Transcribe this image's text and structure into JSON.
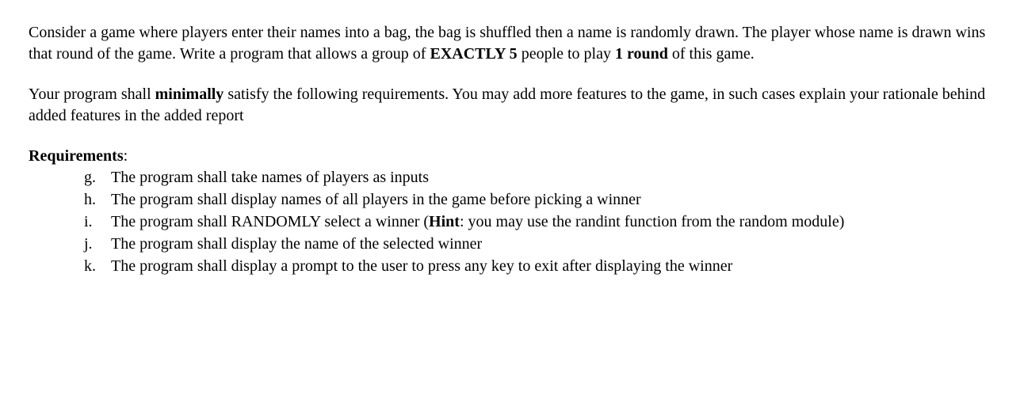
{
  "paragraph1": {
    "part1": "Consider a game where players enter their names into a bag, the bag is shuffled then a name is randomly drawn. The player whose name is drawn wins that round of the game. Write a program that allows a group of ",
    "bold1": "EXACTLY 5",
    "part2": " people to play ",
    "bold2": "1 round",
    "part3": " of this game."
  },
  "paragraph2": {
    "part1": "Your program shall ",
    "bold1": "minimally",
    "part2": " satisfy the following requirements. You may add more features to the game, in such cases explain your rationale behind added features in the added report"
  },
  "requirementsHeading": "Requirements",
  "requirementsColon": ":",
  "requirements": [
    {
      "marker": "g.",
      "text": "The program shall take names of players as inputs"
    },
    {
      "marker": "h.",
      "text": "The program shall display names of all players in the game before picking a winner"
    },
    {
      "marker": "i.",
      "textPart1": "The program shall RANDOMLY select a winner (",
      "boldPart": "Hint",
      "textPart2": ": you may use the randint function from the random module)"
    },
    {
      "marker": "j.",
      "text": "The program shall display the name of the selected winner"
    },
    {
      "marker": "k.",
      "text": "The program shall display a prompt to the user to press any key to exit after displaying the winner"
    }
  ]
}
